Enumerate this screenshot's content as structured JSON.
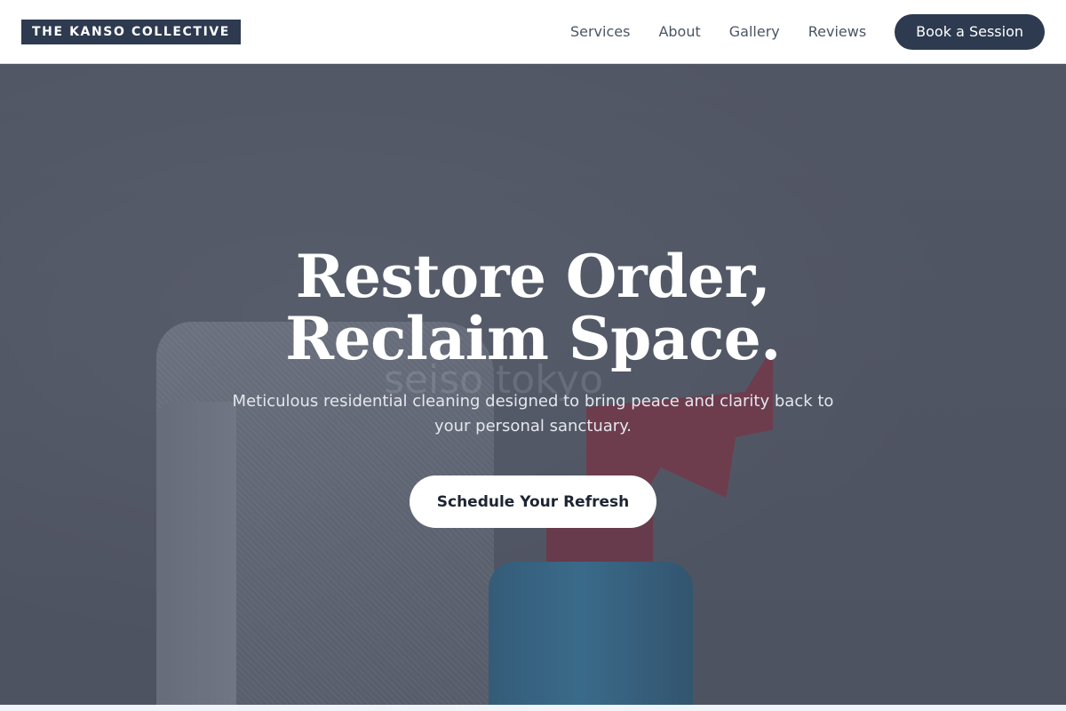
{
  "header": {
    "logo": "THE KANSO COLLECTIVE",
    "nav": [
      {
        "label": "Services"
      },
      {
        "label": "About"
      },
      {
        "label": "Gallery"
      },
      {
        "label": "Reviews"
      }
    ],
    "cta_label": "Book a Session"
  },
  "hero": {
    "title_line1": "Restore Order,",
    "title_line2": "Reclaim Space.",
    "subtitle": "Meticulous residential cleaning designed to bring peace and clarity back to your personal sanctuary.",
    "cta_label": "Schedule Your Refresh",
    "watermark": "seiso tokyo"
  },
  "colors": {
    "brand_dark": "#2d3a4f",
    "hero_overlay": "#474c5c",
    "cta_background": "#ffffff"
  }
}
